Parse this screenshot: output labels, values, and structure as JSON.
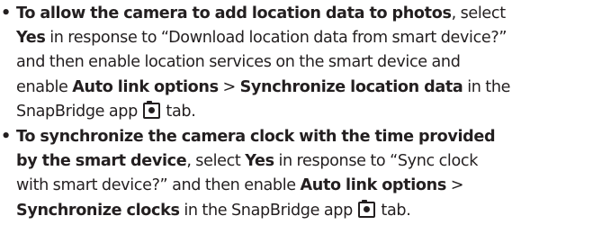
{
  "bullet_char": "•",
  "items": [
    {
      "lines": [
        [
          {
            "t": "b",
            "v": "To allow the camera to add location data to photos"
          },
          {
            "t": "n",
            "v": ", select"
          }
        ],
        [
          {
            "t": "b",
            "v": "Yes"
          },
          {
            "t": "n",
            "v": " in response to “Download location data from smart device?”"
          }
        ],
        [
          {
            "t": "n",
            "v": "and then enable location services on the smart device and"
          }
        ],
        [
          {
            "t": "n",
            "v": "enable "
          },
          {
            "t": "b",
            "v": "Auto link options"
          },
          {
            "t": "n",
            "v": " > "
          },
          {
            "t": "b",
            "v": "Synchronize location data"
          },
          {
            "t": "n",
            "v": " in the"
          }
        ],
        [
          {
            "t": "n",
            "v": "SnapBridge app "
          },
          {
            "t": "icon",
            "v": "camera-tab-icon"
          },
          {
            "t": "n",
            "v": " tab."
          }
        ]
      ]
    },
    {
      "lines": [
        [
          {
            "t": "b",
            "v": "To synchronize the camera clock with the time provided"
          }
        ],
        [
          {
            "t": "b",
            "v": "by the smart device"
          },
          {
            "t": "n",
            "v": ", select "
          },
          {
            "t": "b",
            "v": "Yes"
          },
          {
            "t": "n",
            "v": " in response to “Sync clock"
          }
        ],
        [
          {
            "t": "n",
            "v": "with smart device?” and then enable "
          },
          {
            "t": "b",
            "v": "Auto link options"
          },
          {
            "t": "n",
            "v": " >"
          }
        ],
        [
          {
            "t": "b",
            "v": "Synchronize clocks"
          },
          {
            "t": "n",
            "v": " in the SnapBridge app "
          },
          {
            "t": "icon",
            "v": "camera-tab-icon"
          },
          {
            "t": "n",
            "v": " tab."
          }
        ]
      ]
    }
  ]
}
